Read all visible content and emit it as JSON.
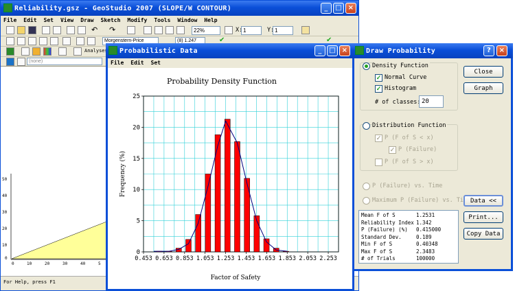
{
  "main_window": {
    "title": "Reliability.gsz - GeoStudio 2007 (SLOPE/W CONTOUR)",
    "menu": [
      "File",
      "Edit",
      "Set",
      "View",
      "Draw",
      "Sketch",
      "Modify",
      "Tools",
      "Window",
      "Help"
    ],
    "zoom_value": "22%",
    "x_field": "1",
    "y_field": "1",
    "x_label": "X:",
    "y_label": "Y:",
    "method": "Morgenstern-Price",
    "fos": "(8) 1.247",
    "analysis_label": "Analyses",
    "filter": "(none)",
    "status": "For Help, press F1",
    "y_ticks": [
      "50",
      "40",
      "30",
      "20",
      "10",
      "0"
    ],
    "x_ticks": [
      "0",
      "10",
      "20",
      "30",
      "40",
      "5"
    ]
  },
  "prob_window": {
    "title": "Probabilistic Data",
    "menu": [
      "File",
      "Edit",
      "Set"
    ]
  },
  "chart_data": {
    "type": "bar",
    "title": "Probability Density Function",
    "xlabel": "Factor of Safety",
    "ylabel": "Frequency (%)",
    "ylim": [
      0,
      25
    ],
    "y_ticks": [
      0,
      5,
      10,
      15,
      20,
      25
    ],
    "x_tick_labels": [
      "0.453",
      "0.653",
      "0.853",
      "1.053",
      "1.253",
      "1.453",
      "1.653",
      "1.853",
      "2.053",
      "2.253"
    ],
    "xlim": [
      0.453,
      2.353
    ],
    "bars": [
      {
        "x": 0.606,
        "value": 0.1
      },
      {
        "x": 0.701,
        "value": 0.1
      },
      {
        "x": 0.796,
        "value": 0.6
      },
      {
        "x": 0.891,
        "value": 2.0
      },
      {
        "x": 0.986,
        "value": 6.0
      },
      {
        "x": 1.081,
        "value": 12.5
      },
      {
        "x": 1.176,
        "value": 18.8
      },
      {
        "x": 1.271,
        "value": 21.3
      },
      {
        "x": 1.366,
        "value": 17.7
      },
      {
        "x": 1.461,
        "value": 11.8
      },
      {
        "x": 1.556,
        "value": 5.8
      },
      {
        "x": 1.651,
        "value": 2.1
      },
      {
        "x": 1.746,
        "value": 0.6
      },
      {
        "x": 1.841,
        "value": 0.1
      }
    ],
    "normal_curve": [
      [
        0.553,
        0.1
      ],
      [
        0.701,
        0.1
      ],
      [
        0.796,
        0.4
      ],
      [
        0.891,
        1.3
      ],
      [
        0.986,
        4.6
      ],
      [
        1.081,
        10.5
      ],
      [
        1.176,
        17.0
      ],
      [
        1.253,
        21.0
      ],
      [
        1.366,
        17.5
      ],
      [
        1.461,
        11.0
      ],
      [
        1.556,
        5.0
      ],
      [
        1.651,
        1.6
      ],
      [
        1.746,
        0.3
      ],
      [
        1.853,
        0.1
      ]
    ],
    "grid": true
  },
  "draw_window": {
    "title": "Draw Probability",
    "density_function": "Density Function",
    "normal_curve": "Normal Curve",
    "histogram": "Histogram",
    "classes_label": "# of classes:",
    "classes_value": "20",
    "distribution_function": "Distribution Function",
    "pf_less": "P (F of S < x)",
    "p_failure": "P (Failure)",
    "pf_greater": "P (F of S > x)",
    "pf_vs_time": "P (Failure) vs. Time",
    "max_pf_vs_time": "Maximum P (Failure) vs. Time",
    "buttons": {
      "close": "Close",
      "graph": "Graph",
      "data": "Data <<",
      "print": "Print...",
      "copy": "Copy Data"
    },
    "stats": [
      {
        "label": "Mean F of S",
        "value": "1.2531"
      },
      {
        "label": "Reliability Index",
        "value": "1.342"
      },
      {
        "label": "P (Failure) (%)",
        "value": "0.415000"
      },
      {
        "label": "Standard Dev.",
        "value": "0.189"
      },
      {
        "label": "Min F of S",
        "value": "0.40348"
      },
      {
        "label": "Max F of S",
        "value": "2.3483"
      },
      {
        "label": "# of Trials",
        "value": "100000"
      }
    ]
  }
}
